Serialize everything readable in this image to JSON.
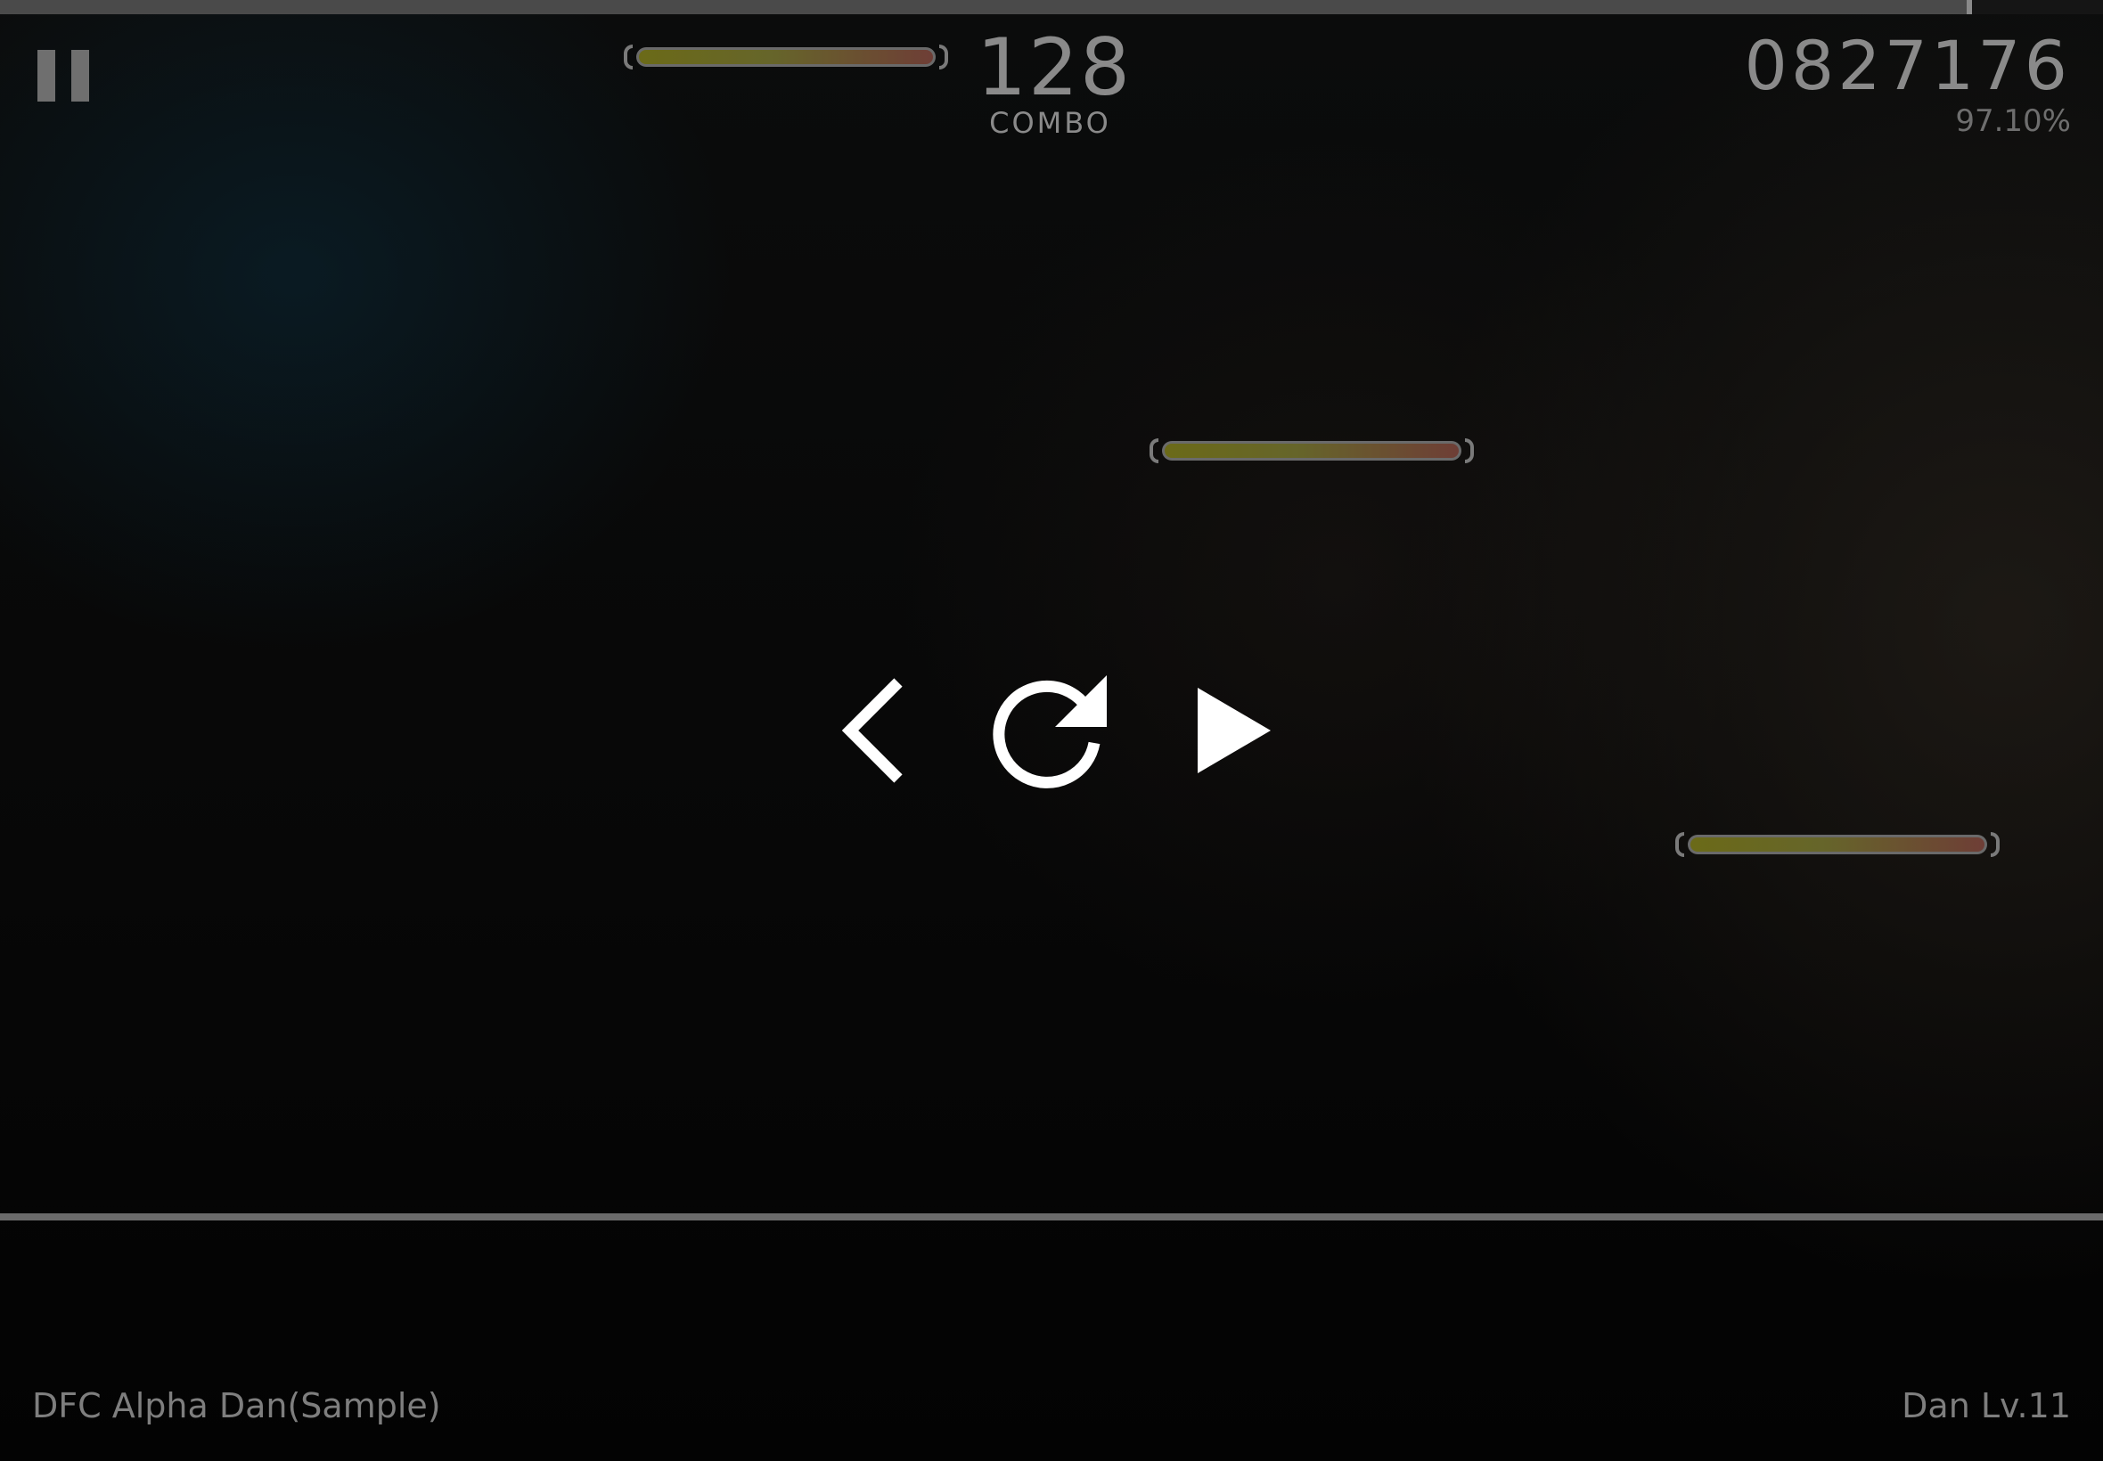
{
  "progress": {
    "fraction": 0.935
  },
  "hud": {
    "combo": "128",
    "combo_label": "COMBO",
    "score": "0827176",
    "accuracy": "97.10%"
  },
  "pause_menu": {
    "back_icon": "chevron-left-icon",
    "retry_icon": "restart-icon",
    "resume_icon": "play-icon"
  },
  "footer": {
    "song_title": "DFC Alpha Dan(Sample)",
    "level": "Dan Lv.11"
  },
  "colors": {
    "hud_text": "#8a8a8a",
    "line_fill_start": "#6b6a18",
    "line_fill_end": "#6e3e36",
    "icon": "#ffffff"
  }
}
